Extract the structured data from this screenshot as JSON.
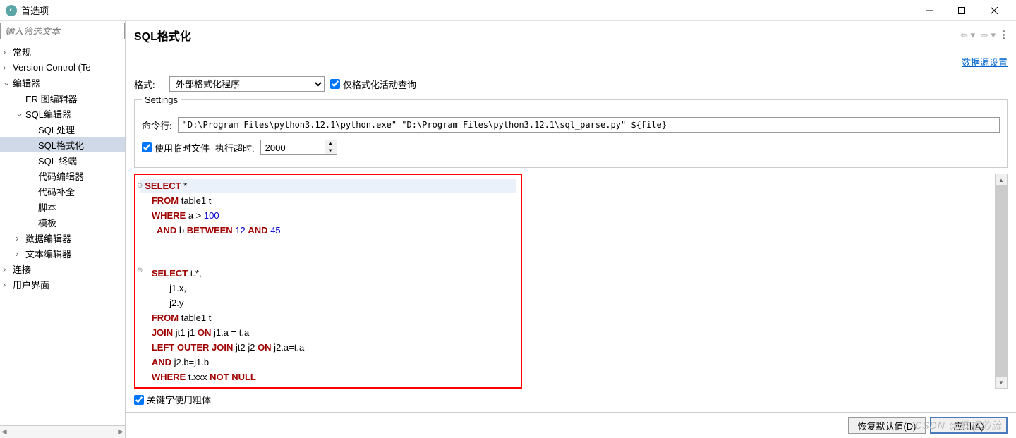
{
  "window": {
    "title": "首选项"
  },
  "sidebar": {
    "filter_placeholder": "输入筛选文本",
    "items": [
      {
        "label": "常规",
        "level": 1,
        "chevron": ">"
      },
      {
        "label": "Version Control (Te",
        "level": 1,
        "chevron": ">"
      },
      {
        "label": "编辑器",
        "level": 1,
        "chevron": "v"
      },
      {
        "label": "ER 图编辑器",
        "level": 2,
        "chevron": ""
      },
      {
        "label": "SQL编辑器",
        "level": 2,
        "chevron": "v"
      },
      {
        "label": "SQL处理",
        "level": 3,
        "chevron": ""
      },
      {
        "label": "SQL格式化",
        "level": 3,
        "chevron": "",
        "selected": true
      },
      {
        "label": "SQL 终端",
        "level": 3,
        "chevron": ""
      },
      {
        "label": "代码编辑器",
        "level": 3,
        "chevron": ""
      },
      {
        "label": "代码补全",
        "level": 3,
        "chevron": ""
      },
      {
        "label": "脚本",
        "level": 3,
        "chevron": ""
      },
      {
        "label": "模板",
        "level": 3,
        "chevron": ""
      },
      {
        "label": "数据编辑器",
        "level": 2,
        "chevron": ">"
      },
      {
        "label": "文本编辑器",
        "level": 2,
        "chevron": ">"
      },
      {
        "label": "连接",
        "level": 1,
        "chevron": ">"
      },
      {
        "label": "用户界面",
        "level": 1,
        "chevron": ">"
      }
    ]
  },
  "header": {
    "title": "SQL格式化"
  },
  "body": {
    "datasource_link": "数据源设置",
    "format_label": "格式:",
    "format_value": "外部格式化程序",
    "active_only_label": "仅格式化活动查询",
    "settings_legend": "Settings",
    "command_label": "命令行:",
    "command_value": "\"D:\\Program Files\\python3.12.1\\python.exe\" \"D:\\Program Files\\python3.12.1\\sql_parse.py\" ${file}",
    "use_tempfile_label": "使用临时文件",
    "timeout_label": "执行超时:",
    "timeout_value": "2000",
    "bold_keywords_label": "关键字使用粗体"
  },
  "chart_data": {
    "type": "code",
    "lines": [
      {
        "fold": "⊖",
        "tokens": [
          {
            "t": "SELECT",
            "c": "kw"
          },
          {
            "t": " *",
            "c": "ident"
          }
        ],
        "highlight": true
      },
      {
        "tokens": [
          {
            "t": "FROM",
            "c": "kw"
          },
          {
            "t": " table1 t",
            "c": "ident"
          }
        ]
      },
      {
        "tokens": [
          {
            "t": "WHERE",
            "c": "kw"
          },
          {
            "t": " a > ",
            "c": "ident"
          },
          {
            "t": "100",
            "c": "num"
          }
        ]
      },
      {
        "tokens": [
          {
            "t": "  ",
            "c": "ident"
          },
          {
            "t": "AND",
            "c": "kw"
          },
          {
            "t": " b ",
            "c": "ident"
          },
          {
            "t": "BETWEEN",
            "c": "kw"
          },
          {
            "t": " ",
            "c": "ident"
          },
          {
            "t": "12",
            "c": "num"
          },
          {
            "t": " ",
            "c": "ident"
          },
          {
            "t": "AND",
            "c": "kw"
          },
          {
            "t": " ",
            "c": "ident"
          },
          {
            "t": "45",
            "c": "num"
          }
        ]
      },
      {
        "tokens": []
      },
      {
        "tokens": []
      },
      {
        "fold": "⊖",
        "tokens": [
          {
            "t": "SELECT",
            "c": "kw"
          },
          {
            "t": " t.*,",
            "c": "ident"
          }
        ]
      },
      {
        "tokens": [
          {
            "t": "       j1.x,",
            "c": "ident"
          }
        ]
      },
      {
        "tokens": [
          {
            "t": "       j2.y",
            "c": "ident"
          }
        ]
      },
      {
        "tokens": [
          {
            "t": "FROM",
            "c": "kw"
          },
          {
            "t": " table1 t",
            "c": "ident"
          }
        ]
      },
      {
        "tokens": [
          {
            "t": "JOIN",
            "c": "kw"
          },
          {
            "t": " jt1 j1 ",
            "c": "ident"
          },
          {
            "t": "ON",
            "c": "kw"
          },
          {
            "t": " j1.a = t.a",
            "c": "ident"
          }
        ]
      },
      {
        "tokens": [
          {
            "t": "LEFT OUTER JOIN",
            "c": "kw"
          },
          {
            "t": " jt2 j2 ",
            "c": "ident"
          },
          {
            "t": "ON",
            "c": "kw"
          },
          {
            "t": " j2.a=t.a",
            "c": "ident"
          }
        ]
      },
      {
        "tokens": [
          {
            "t": "AND",
            "c": "kw"
          },
          {
            "t": " j2.b=j1.b",
            "c": "ident"
          }
        ]
      },
      {
        "tokens": [
          {
            "t": "WHERE",
            "c": "kw"
          },
          {
            "t": " t.xxx ",
            "c": "ident"
          },
          {
            "t": "NOT NULL",
            "c": "kw"
          }
        ]
      }
    ]
  },
  "footer": {
    "restore_defaults": "恢复默认值(D)",
    "apply": "应用(A)"
  },
  "watermark": "CSDN @数据的流"
}
